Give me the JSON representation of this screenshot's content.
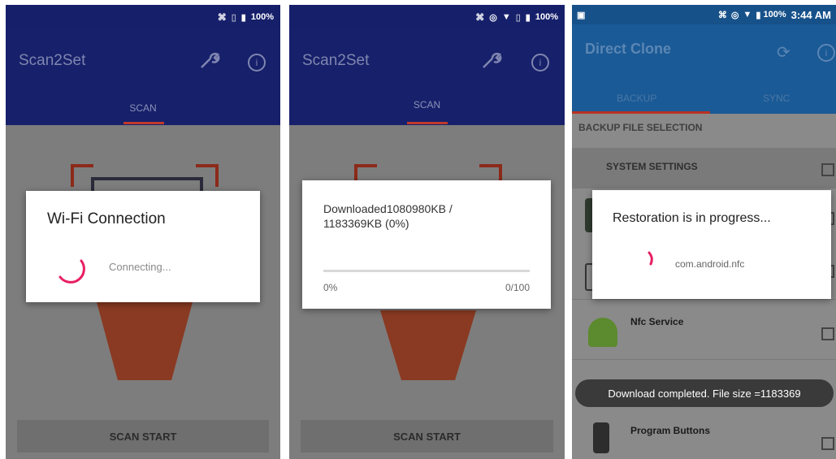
{
  "screen1": {
    "status_battery": "100%",
    "app_title": "Scan2Set",
    "tab_scan": "SCAN",
    "dialog_title": "Wi-Fi Connection",
    "dialog_message": "Connecting...",
    "button_scan_start": "SCAN START"
  },
  "screen2": {
    "status_battery": "100%",
    "app_title": "Scan2Set",
    "tab_scan": "SCAN",
    "dialog_message": "Downloaded1080980KB / 1183369KB (0%)",
    "progress_percent": "0%",
    "progress_count": "0/100",
    "progress_fraction": 0,
    "button_scan_start": "SCAN START"
  },
  "screen3": {
    "status_battery": "100%",
    "status_time": "3:44 AM",
    "app_title": "Direct Clone",
    "tab_backup": "BACKUP",
    "tab_sync": "SYNC",
    "section_header": "BACKUP FILE SELECTION",
    "item_system_settings": "SYSTEM SETTINGS",
    "item_nfc_service": "Nfc Service",
    "item_program_buttons": "Program Buttons",
    "dialog_title": "Restoration is in progress...",
    "dialog_message": "com.android.nfc",
    "toast": "Download completed. File size =1183369"
  },
  "colors": {
    "app_bar": "#17206a",
    "accent": "#e91e63",
    "bracket_red": "#c62828",
    "direct_clone_bar": "#1a5a96"
  }
}
